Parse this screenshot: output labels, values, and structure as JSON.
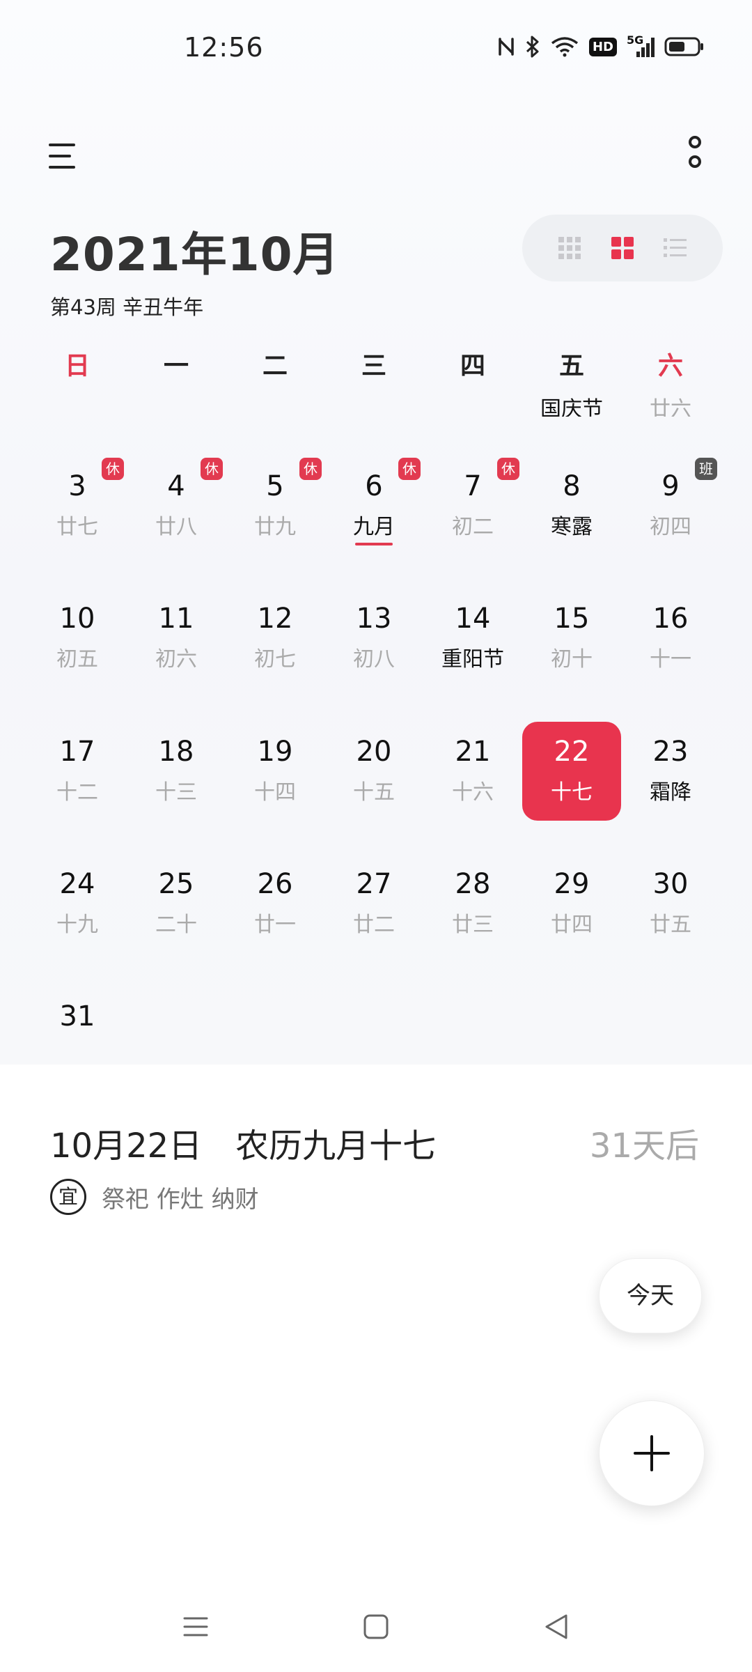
{
  "status_bar": {
    "time": "12:56",
    "icons": [
      "nfc-icon",
      "bluetooth-icon",
      "wifi-icon",
      "hd-icon",
      "5g-signal-icon",
      "battery-icon"
    ],
    "hd_label": "HD",
    "network_label": "5G"
  },
  "header": {
    "month_title": "2021年10月",
    "week_info": "第43周 辛丑牛年",
    "view_modes": [
      "month-grid-icon",
      "week-grid-icon",
      "list-icon"
    ],
    "active_view": "week-grid-icon"
  },
  "weekdays": [
    "日",
    "一",
    "二",
    "三",
    "四",
    "五",
    "六"
  ],
  "calendar": {
    "partial_row": [
      {
        "col": 5,
        "lunar": "国庆节"
      },
      {
        "col": 6,
        "lunar": "廿六"
      }
    ],
    "weeks": [
      [
        {
          "day": "3",
          "lunar": "廿七",
          "badge": "休"
        },
        {
          "day": "4",
          "lunar": "廿八",
          "badge": "休"
        },
        {
          "day": "5",
          "lunar": "廿九",
          "badge": "休"
        },
        {
          "day": "6",
          "lunar": "九月",
          "badge": "休",
          "festival": true,
          "underline": true
        },
        {
          "day": "7",
          "lunar": "初二",
          "badge": "休"
        },
        {
          "day": "8",
          "lunar": "寒露",
          "festival": true
        },
        {
          "day": "9",
          "lunar": "初四",
          "badge": "班",
          "badge_type": "work"
        }
      ],
      [
        {
          "day": "10",
          "lunar": "初五"
        },
        {
          "day": "11",
          "lunar": "初六"
        },
        {
          "day": "12",
          "lunar": "初七"
        },
        {
          "day": "13",
          "lunar": "初八"
        },
        {
          "day": "14",
          "lunar": "重阳节",
          "festival": true
        },
        {
          "day": "15",
          "lunar": "初十"
        },
        {
          "day": "16",
          "lunar": "十一"
        }
      ],
      [
        {
          "day": "17",
          "lunar": "十二"
        },
        {
          "day": "18",
          "lunar": "十三"
        },
        {
          "day": "19",
          "lunar": "十四"
        },
        {
          "day": "20",
          "lunar": "十五"
        },
        {
          "day": "21",
          "lunar": "十六"
        },
        {
          "day": "22",
          "lunar": "十七",
          "selected": true
        },
        {
          "day": "23",
          "lunar": "霜降",
          "festival": true
        }
      ],
      [
        {
          "day": "24",
          "lunar": "十九"
        },
        {
          "day": "25",
          "lunar": "二十"
        },
        {
          "day": "26",
          "lunar": "廿一"
        },
        {
          "day": "27",
          "lunar": "廿二"
        },
        {
          "day": "28",
          "lunar": "廿三"
        },
        {
          "day": "29",
          "lunar": "廿四"
        },
        {
          "day": "30",
          "lunar": "廿五"
        }
      ],
      [
        {
          "day": "31",
          "lunar": ""
        }
      ]
    ]
  },
  "selected_date": {
    "date": "10月22日",
    "lunar": "农历九月十七",
    "days_after": "31天后",
    "yi_label": "宜",
    "yi_items": "祭祀 作灶 纳财"
  },
  "buttons": {
    "today_label": "今天"
  },
  "colors": {
    "accent": "#e8344e",
    "weekend": "#e23a50",
    "work_badge": "#555555",
    "lunar_gray": "#aaaaaa"
  },
  "nav_bar": {
    "icons": [
      "recent-apps-icon",
      "home-icon",
      "back-icon"
    ]
  }
}
